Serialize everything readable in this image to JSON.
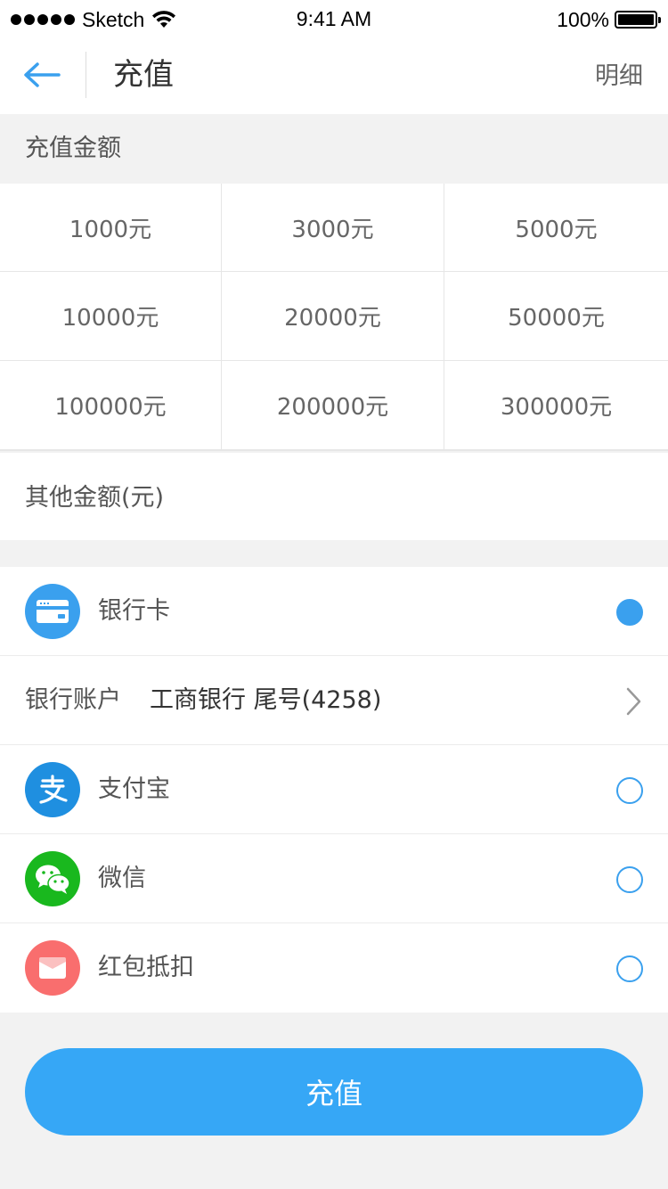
{
  "status_bar": {
    "carrier": "Sketch",
    "time": "9:41 AM",
    "battery": "100%"
  },
  "nav": {
    "title": "充值",
    "detail_label": "明细"
  },
  "amount_section": {
    "title": "充值金额",
    "options": [
      "1000元",
      "3000元",
      "5000元",
      "10000元",
      "20000元",
      "50000元",
      "100000元",
      "200000元",
      "300000元"
    ],
    "other_placeholder": "其他金额(元)"
  },
  "payment": {
    "bank_card": {
      "label": "银行卡",
      "icon": "credit-card-icon",
      "color": "#3aa0ee",
      "selected": true
    },
    "bank_account": {
      "label": "银行账户",
      "value": "工商银行 尾号(4258)"
    },
    "alipay": {
      "label": "支付宝",
      "icon": "alipay-icon",
      "color": "#1f8fe0",
      "selected": false
    },
    "wechat": {
      "label": "微信",
      "icon": "wechat-icon",
      "color": "#19b81e",
      "selected": false
    },
    "red_packet": {
      "label": "红包抵扣",
      "icon": "envelope-icon",
      "color": "#f96e6e",
      "selected": false
    }
  },
  "submit": {
    "label": "充值"
  },
  "colors": {
    "accent": "#36a7f6",
    "background": "#f2f2f2"
  }
}
